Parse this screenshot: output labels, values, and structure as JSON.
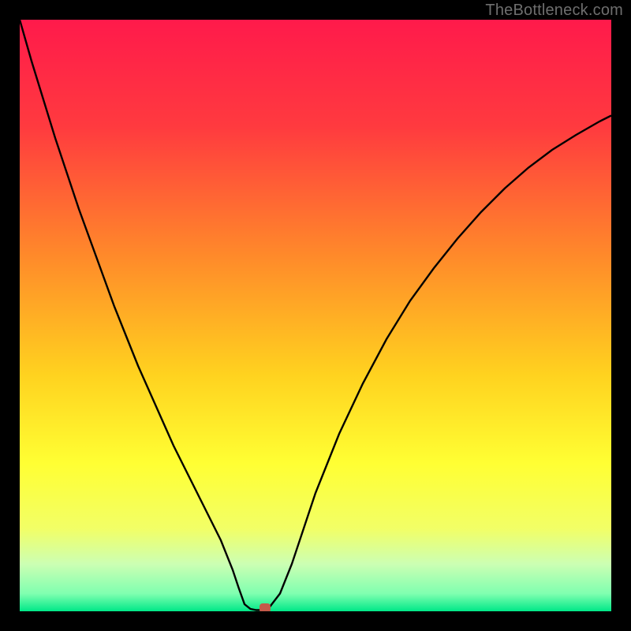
{
  "watermark": "TheBottleneck.com",
  "colors": {
    "gradient_stops": [
      {
        "pct": 0,
        "color": "#ff1a4b"
      },
      {
        "pct": 18,
        "color": "#ff3a3f"
      },
      {
        "pct": 40,
        "color": "#ff8a2a"
      },
      {
        "pct": 60,
        "color": "#ffd21f"
      },
      {
        "pct": 75,
        "color": "#ffff33"
      },
      {
        "pct": 86,
        "color": "#f2ff66"
      },
      {
        "pct": 92,
        "color": "#ccffb3"
      },
      {
        "pct": 97,
        "color": "#80ffb0"
      },
      {
        "pct": 100,
        "color": "#00e888"
      }
    ],
    "marker": "#c4594a"
  },
  "chart_data": {
    "type": "line",
    "title": "",
    "xlabel": "",
    "ylabel": "",
    "xlim": [
      0,
      100
    ],
    "ylim": [
      0,
      100
    ],
    "x": [
      0,
      2,
      4,
      6,
      8,
      10,
      12,
      14,
      16,
      18,
      20,
      22,
      24,
      26,
      28,
      30,
      32,
      34,
      36,
      37,
      38,
      39,
      40,
      41,
      42,
      44,
      46,
      48,
      50,
      54,
      58,
      62,
      66,
      70,
      74,
      78,
      82,
      86,
      90,
      94,
      98,
      100
    ],
    "y": [
      100,
      93,
      86.5,
      80,
      74,
      68,
      62.5,
      57,
      51.5,
      46.5,
      41.5,
      37,
      32.5,
      28,
      24,
      20,
      16,
      12,
      7,
      4,
      1.2,
      0.4,
      0.2,
      0.2,
      0.4,
      3,
      8,
      14,
      20,
      30,
      38.5,
      46,
      52.5,
      58,
      63,
      67.5,
      71.5,
      75,
      78,
      80.5,
      82.8,
      83.8
    ],
    "flat_segment": {
      "x0": 38.5,
      "x1": 41.5,
      "y": 0.2
    },
    "marker": {
      "x": 41.5,
      "y": 0.5
    }
  }
}
